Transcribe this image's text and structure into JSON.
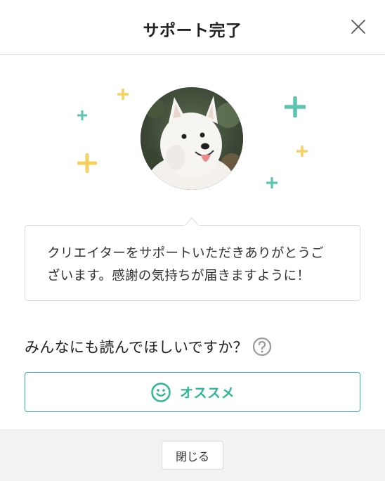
{
  "dialog": {
    "title": "サポート完了",
    "close_icon": "close-icon"
  },
  "hero": {
    "avatar_icon": "dog-avatar",
    "sparkle_colors": {
      "yellow": "#f7d060",
      "teal": "#5cc5b0"
    }
  },
  "message": {
    "line1": "クリエイターをサポートいただきありがとうご",
    "line2": "ざいます。感謝の気持ちが届きますように！"
  },
  "recommend": {
    "question": "みんなにも読んでほしいですか？",
    "help_icon": "question-circle-icon",
    "button_label": "オススメ",
    "button_icon": "smile-icon",
    "accent_color": "#2cb696"
  },
  "footer": {
    "close_label": "閉じる"
  }
}
